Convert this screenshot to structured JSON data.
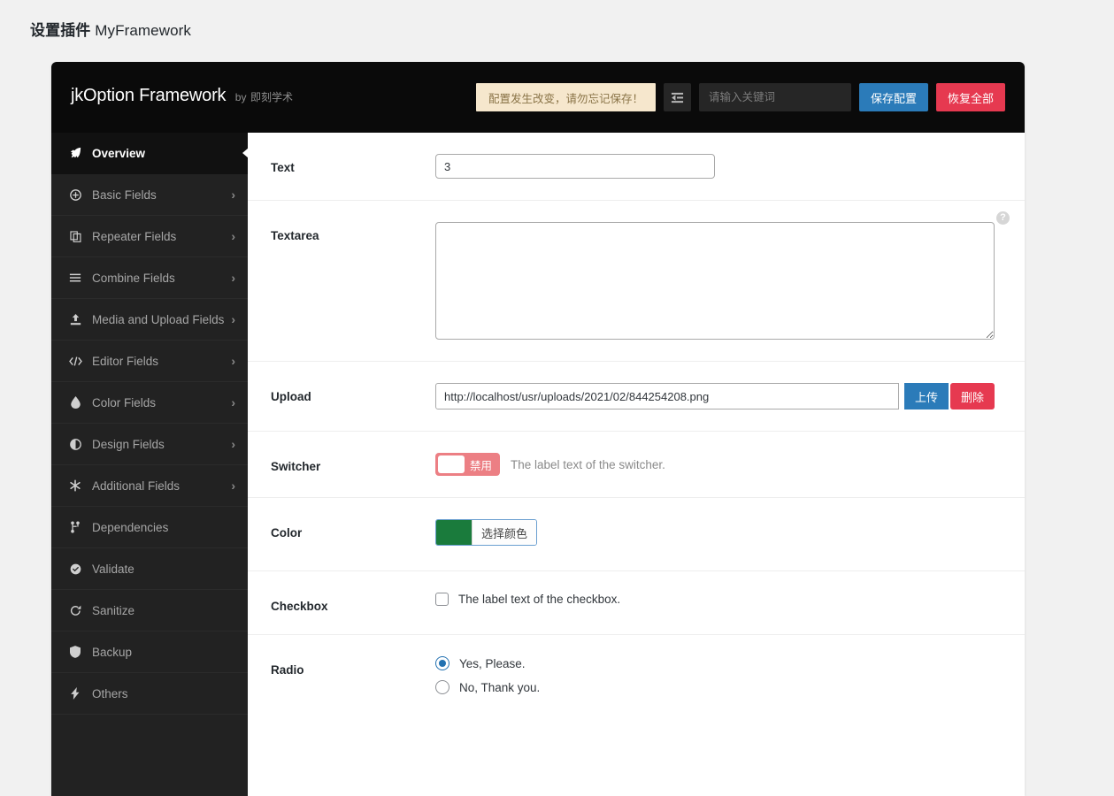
{
  "page": {
    "title_zh": "设置插件",
    "title_name": "MyFramework"
  },
  "header": {
    "brand_name": "jkOption Framework",
    "brand_by": "by",
    "brand_author": "即刻学术",
    "save_notice": "配置发生改变，请勿忘记保存！",
    "expand_icon": "collapse-sidebar-icon",
    "search_placeholder": "请输入关键词",
    "search_value": "",
    "save_label": "保存配置",
    "reset_label": "恢复全部",
    "save_color": "#2b7bb9",
    "reset_color": "#e63950",
    "notice_bg": "#f6e7cd"
  },
  "sidebar": {
    "items": [
      {
        "label": "Overview",
        "icon": "rocket-icon",
        "active": true,
        "arrow": ""
      },
      {
        "label": "Basic Fields",
        "icon": "plus-circle-icon",
        "active": false,
        "arrow": "›"
      },
      {
        "label": "Repeater Fields",
        "icon": "copy-icon",
        "active": false,
        "arrow": "›"
      },
      {
        "label": "Combine Fields",
        "icon": "list-icon",
        "active": false,
        "arrow": "›"
      },
      {
        "label": "Media and Upload Fields",
        "icon": "upload-icon",
        "active": false,
        "arrow": "›"
      },
      {
        "label": "Editor Fields",
        "icon": "code-icon",
        "active": false,
        "arrow": "›"
      },
      {
        "label": "Color Fields",
        "icon": "droplet-icon",
        "active": false,
        "arrow": "›"
      },
      {
        "label": "Design Fields",
        "icon": "contrast-icon",
        "active": false,
        "arrow": "›"
      },
      {
        "label": "Additional Fields",
        "icon": "asterisk-icon",
        "active": false,
        "arrow": "›"
      },
      {
        "label": "Dependencies",
        "icon": "branch-icon",
        "active": false,
        "arrow": ""
      },
      {
        "label": "Validate",
        "icon": "check-circle-icon",
        "active": false,
        "arrow": ""
      },
      {
        "label": "Sanitize",
        "icon": "refresh-icon",
        "active": false,
        "arrow": ""
      },
      {
        "label": "Backup",
        "icon": "shield-icon",
        "active": false,
        "arrow": ""
      },
      {
        "label": "Others",
        "icon": "bolt-icon",
        "active": false,
        "arrow": ""
      }
    ]
  },
  "fields": {
    "text": {
      "label": "Text",
      "value": "3",
      "placeholder": ""
    },
    "textarea": {
      "label": "Textarea",
      "value": "",
      "placeholder": "",
      "help_icon": "question-mark-icon"
    },
    "upload": {
      "label": "Upload",
      "value": "http://localhost/usr/uploads/2021/02/844254208.png",
      "placeholder": "",
      "upload_label": "上传",
      "remove_label": "删除"
    },
    "switcher": {
      "label": "Switcher",
      "state_label": "禁用",
      "caption": "The label text of the switcher.",
      "off_color": "#ec7f84"
    },
    "color": {
      "label": "Color",
      "swatch": "#1a7b3c",
      "button_label": "选择颜色"
    },
    "checkbox": {
      "label": "Checkbox",
      "caption": "The label text of the checkbox.",
      "checked": false
    },
    "radio": {
      "label": "Radio",
      "options": [
        {
          "text": "Yes, Please.",
          "checked": true
        },
        {
          "text": "No, Thank you.",
          "checked": false
        }
      ]
    }
  }
}
